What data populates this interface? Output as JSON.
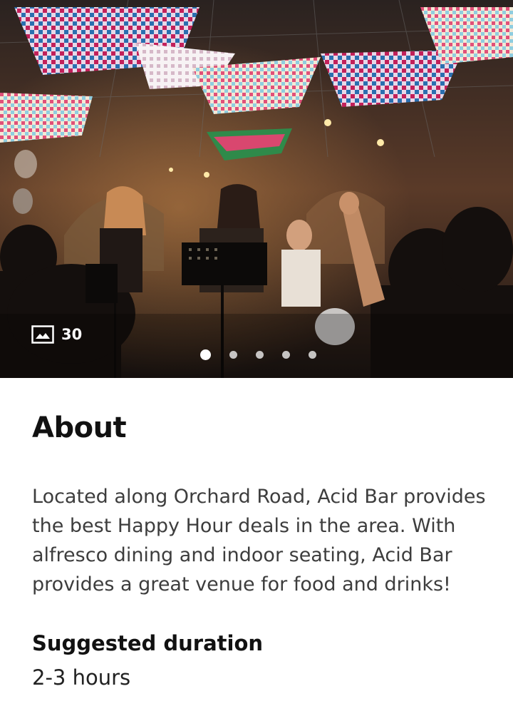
{
  "gallery": {
    "photo_count": "30",
    "photo_icon": "image-icon",
    "pages_total": 5,
    "page_active": 1
  },
  "about": {
    "title": "About",
    "description": "Located along Orchard Road, Acid Bar provides the best Happy Hour deals in the area. With alfresco dining and indoor seating, Acid Bar provides a great venue for food and drinks!"
  },
  "duration": {
    "label": "Suggested duration",
    "value": "2-3 hours"
  }
}
